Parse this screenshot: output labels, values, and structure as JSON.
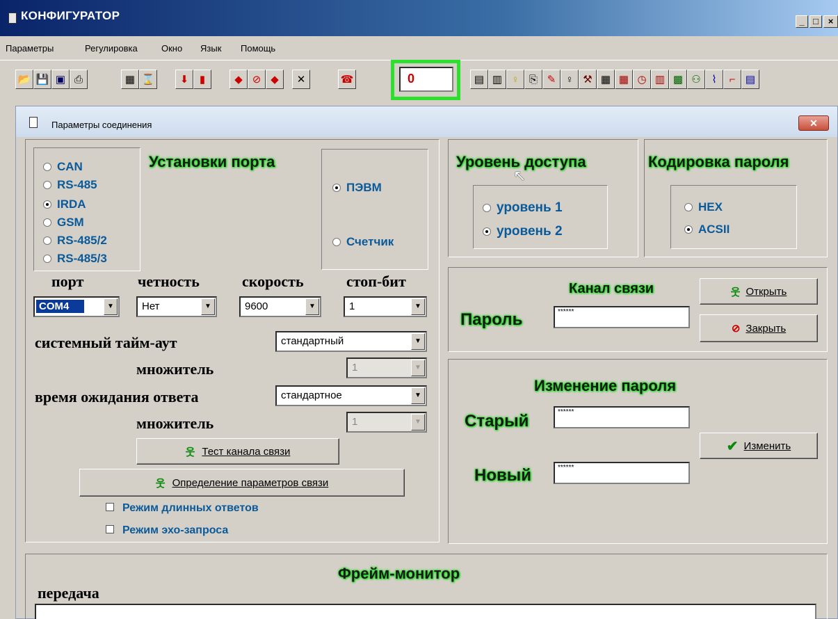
{
  "window": {
    "title": "КОНФИГУРАТОР",
    "min": "_",
    "max": "□",
    "close": "×"
  },
  "menu": [
    "Параметры",
    "Регулировка",
    "Окно",
    "Язык",
    "Помощь"
  ],
  "toolbar": {
    "counter_value": "0"
  },
  "dialog": {
    "title": "Параметры соединения",
    "close": "✕",
    "port_settings": {
      "heading": "Установки порта",
      "interfaces": [
        "CAN",
        "RS-485",
        "IRDA",
        "GSM",
        "RS-485/2",
        "RS-485/3"
      ],
      "selected_interface": "IRDA",
      "device_options": [
        "ПЭВМ",
        "Счетчик"
      ],
      "selected_device": "ПЭВМ",
      "port_label": "порт",
      "parity_label": "четность",
      "speed_label": "скорость",
      "stopbit_label": "стоп-бит",
      "port_value": "COM4",
      "parity_value": "Нет",
      "speed_value": "9600",
      "stopbit_value": "1",
      "sys_timeout_label": "системный тайм-аут",
      "sys_timeout_value": "стандартный",
      "multiplier_label": "множитель",
      "multiplier_value": "1",
      "wait_label": "время ожидания ответа",
      "wait_value": "стандартное",
      "multiplier2_label": "множитель",
      "multiplier2_value": "1",
      "test_button": "Тест канала связи",
      "detect_button": "Определение параметров связи",
      "long_answers": "Режим длинных ответов",
      "echo_mode": "Режим эхо-запроса"
    },
    "access": {
      "heading": "Уровень доступа",
      "options": [
        "уровень 1",
        "уровень 2"
      ],
      "selected": "уровень 2"
    },
    "encoding": {
      "heading": "Кодировка пароля",
      "options": [
        "HEX",
        "ACSII"
      ],
      "selected": "ACSII"
    },
    "channel": {
      "heading": "Канал связи",
      "password_label": "Пароль",
      "password_value": "******",
      "open_button": "Открыть",
      "close_button": "Закрыть"
    },
    "change_password": {
      "heading": "Изменение пароля",
      "old_label": "Старый",
      "old_value": "******",
      "new_label": "Новый",
      "new_value": "******",
      "change_button": "Изменить"
    },
    "frame_monitor": {
      "heading": "Фрейм-монитор",
      "transmit_label": "передача"
    }
  }
}
